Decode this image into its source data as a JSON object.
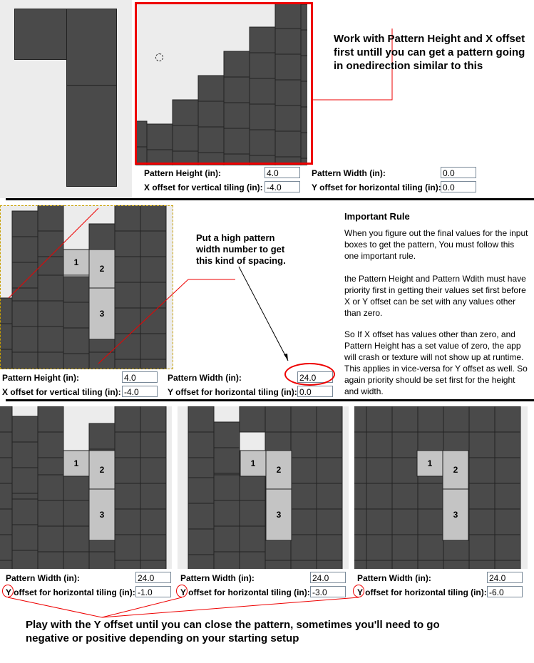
{
  "top_note": "Work with Pattern Height and X offset first untill you can get a pattern going in onedirection similar to this",
  "section1": {
    "fields": [
      {
        "label": "Pattern Height (in):",
        "value": "4.0"
      },
      {
        "label": "Pattern Width (in):",
        "value": "0.0"
      },
      {
        "label": "X offset for vertical tiling (in):",
        "value": "-4.0"
      },
      {
        "label": "Y offset for horizontal tiling (in):",
        "value": "0.0"
      }
    ]
  },
  "middle_note": "Put a high pattern width number to get this kind of spacing.",
  "section2": {
    "tile_numbers": [
      "1",
      "2",
      "3"
    ],
    "fields": [
      {
        "label": "Pattern Height (in):",
        "value": "4.0"
      },
      {
        "label": "Pattern Width (in):",
        "value": "24.0"
      },
      {
        "label": "X offset for vertical tiling (in):",
        "value": "-4.0"
      },
      {
        "label": "Y offset for horizontal tiling (in):",
        "value": "0.0"
      }
    ]
  },
  "rule": {
    "title": "Important Rule",
    "p1": "When you figure out the final values for the input boxes to get the pattern, You must follow this one important rule.",
    "p2": "the Pattern Height and Pattern Wdith must have priority first in getting their values set first before X or Y offset can be set with any values other than zero.",
    "p3": "So If X offset has values other than zero, and Pattern Height has a set value of zero, the app will crash or texture will not show up at runtime. This applies in vice-versa for Y offset as well. So again priority should be set first for the height and width."
  },
  "section3": {
    "tile_numbers": [
      "1",
      "2",
      "3"
    ],
    "panels": [
      {
        "width_label": "Pattern Width (in):",
        "width_value": "24.0",
        "y_label": "Y offset for horizontal tiling (in):",
        "y_value": "-1.0"
      },
      {
        "width_label": "Pattern Width (in):",
        "width_value": "24.0",
        "y_label": "Y offset for horizontal tiling (in):",
        "y_value": "-3.0"
      },
      {
        "width_label": "Pattern Width (in):",
        "width_value": "24.0",
        "y_label": "Y offset for horizontal tiling (in):",
        "y_value": "-6.0"
      }
    ]
  },
  "bottom_note": "Play with the Y offset until you can close the pattern, sometimes you'll need to go negative or positive depending on your starting setup",
  "colors": {
    "tile": "#4a4a4a",
    "tile_highlight": "#c4c4c4",
    "background": "#ececec",
    "annotation": "#e00000"
  }
}
